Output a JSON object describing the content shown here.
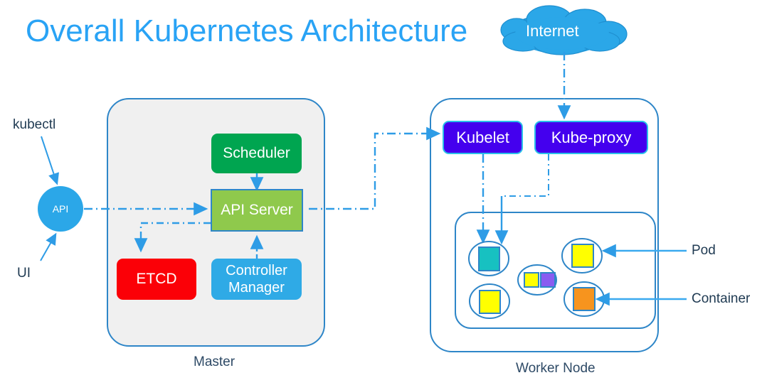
{
  "title": "Overall Kubernetes Architecture",
  "colors": {
    "title": "#29a3f5",
    "accent_blue": "#2e9ce6",
    "master_fill": "#f0f0f0",
    "scheduler": "#00a550",
    "api_server": "#8fc94c",
    "etcd": "#fb0007",
    "controller_manager": "#2faae6",
    "kubelet": "#4400ee",
    "kube_proxy": "#4400ee",
    "cloud": "#2ba7e8",
    "pod_outline": "#2e86c8",
    "container_teal": "#17c1c1",
    "container_yellow": "#ffff00",
    "container_purple": "#8a5cf0",
    "container_orange": "#f7941e",
    "label_text": "#2e4a66"
  },
  "external": {
    "kubectl_label": "kubectl",
    "ui_label": "UI",
    "api_circle_label": "API",
    "internet_label": "Internet"
  },
  "master": {
    "caption": "Master",
    "components": {
      "scheduler": "Scheduler",
      "api_server": "API Server",
      "etcd": "ETCD",
      "controller_manager": "Controller\nManager"
    }
  },
  "worker": {
    "caption": "Worker Node",
    "components": {
      "kubelet": "Kubelet",
      "kube_proxy": "Kube-proxy"
    },
    "pods": [
      {
        "name": "pod-teal",
        "containers": [
          "teal"
        ]
      },
      {
        "name": "pod-yellow-left",
        "containers": [
          "yellow"
        ]
      },
      {
        "name": "pod-multi-center",
        "containers": [
          "yellow",
          "purple"
        ]
      },
      {
        "name": "pod-yellow-right",
        "containers": [
          "yellow"
        ]
      },
      {
        "name": "pod-orange",
        "containers": [
          "orange"
        ]
      }
    ]
  },
  "legend": {
    "pod_label": "Pod",
    "container_label": "Container"
  }
}
